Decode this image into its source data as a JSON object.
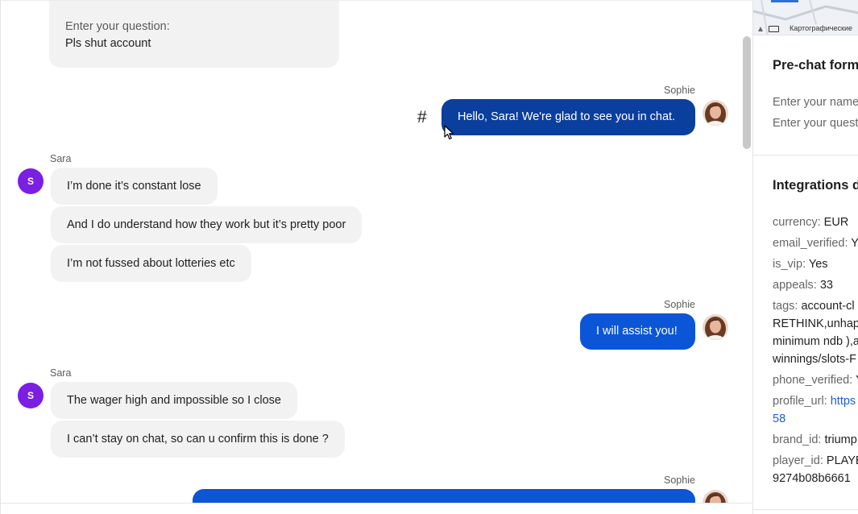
{
  "chat": {
    "quoted_form": {
      "label": "Enter your question:",
      "value": "Pls shut account"
    },
    "messages": [
      {
        "sender": "Sophie",
        "text": "Hello, Sara! We're glad to see you in chat."
      },
      {
        "sender": "Sara",
        "texts": [
          "I’m done it’s constant lose",
          "And I do understand how they work but it’s pretty poor",
          "I’m not fussed about lotteries etc"
        ]
      },
      {
        "sender": "Sophie",
        "text": "I will assist you!"
      },
      {
        "sender": "Sara",
        "texts": [
          "The wager high and impossible so I close",
          "I can’t stay on chat, so can u confirm this is done ?"
        ]
      },
      {
        "sender": "Sophie",
        "text": ""
      }
    ],
    "hash_symbol": "#",
    "visitor_initial": "S",
    "colors": {
      "agent_bubble_dark": "#0b3f9e",
      "agent_bubble": "#0a56d6",
      "visitor_avatar": "#7b1fe3",
      "visitor_bubble": "#f2f2f2"
    }
  },
  "side": {
    "map_attribution": "Картографические",
    "map_keyboard_icon": "keyboard-icon",
    "prechat": {
      "title": "Pre-chat form",
      "name_field": "Enter your name",
      "question_field": "Enter your question"
    },
    "integrations": {
      "title": "Integrations data",
      "items": [
        {
          "key": "currency:",
          "value": "EUR"
        },
        {
          "key": "email_verified:",
          "value": "Yes"
        },
        {
          "key": "is_vip:",
          "value": "Yes"
        },
        {
          "key": "appeals:",
          "value": "33"
        },
        {
          "key": "tags:",
          "value": "account-cl",
          "more": [
            "RETHINK,unhap",
            "minimum ndb ),a",
            "winnings/slots-F"
          ]
        },
        {
          "key": "phone_verified:",
          "value": "Y"
        },
        {
          "key": "profile_url:",
          "value": "https",
          "more": [
            "58"
          ]
        },
        {
          "key": "brand_id:",
          "value": "triump"
        },
        {
          "key": "player_id:",
          "value": "PLAYE",
          "more": [
            "9274b08b6661"
          ]
        }
      ]
    }
  }
}
